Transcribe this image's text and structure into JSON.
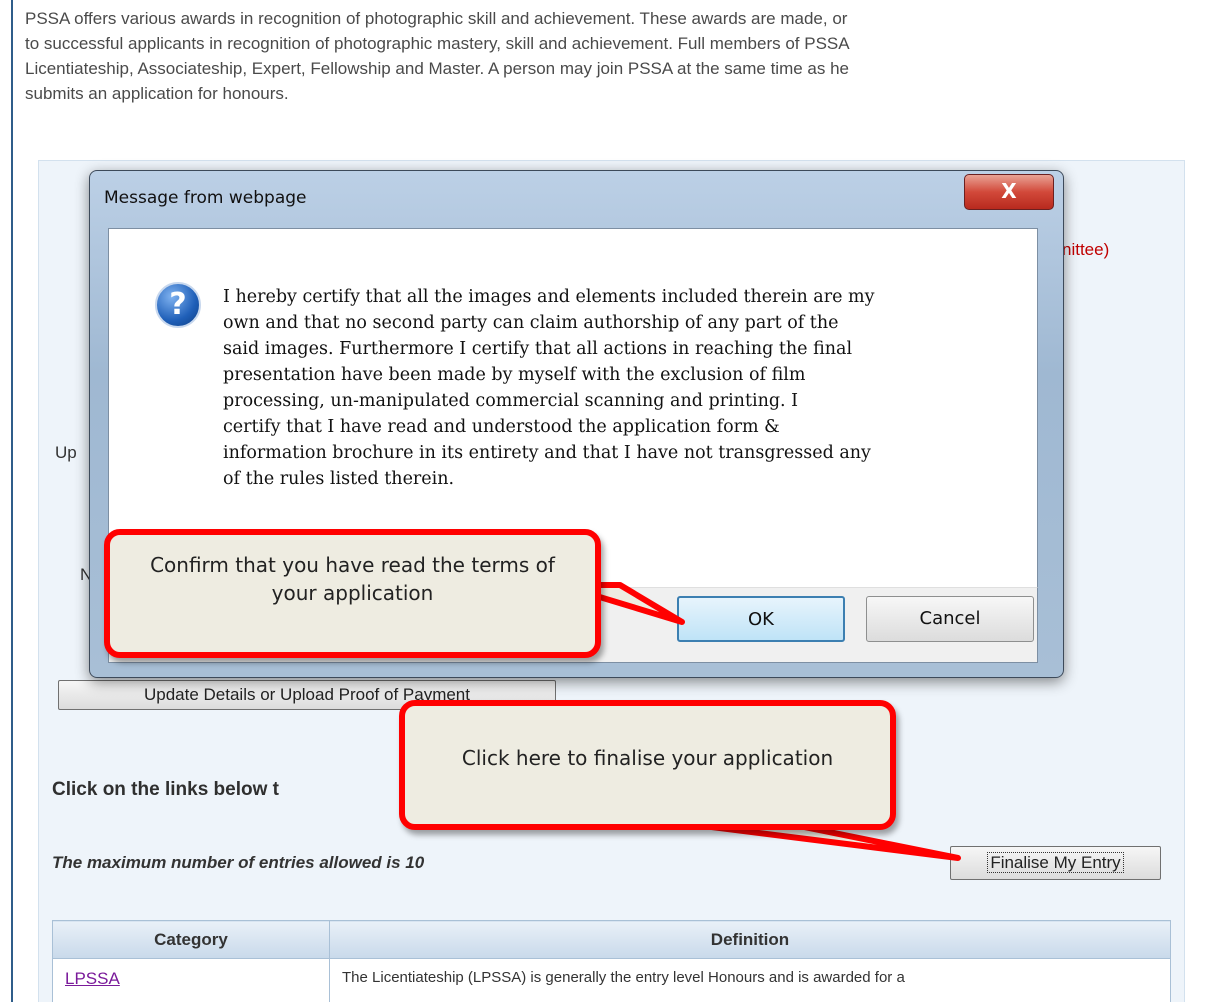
{
  "intro_lines": [
    "PSSA offers various awards in recognition of photographic skill and achievement. These awards are made, or",
    "to successful applicants in recognition of photographic mastery, skill and achievement. Full members of PSSA",
    "Licentiateship, Associateship, Expert, Fellowship and Master. A person may join PSSA at the same time as he",
    "submits an application for honours."
  ],
  "partials": {
    "committee": "nittee)",
    "up": "Up",
    "n": "N"
  },
  "update_button": "Update Details or Upload Proof of Payment",
  "links_heading": "Click on the links below t",
  "max_note": "The maximum number of entries allowed is 10",
  "finalise_button": "Finalise My Entry",
  "table": {
    "headers": [
      "Category",
      "Definition"
    ],
    "rows": [
      {
        "category": "LPSSA",
        "definition": "The Licentiateship (LPSSA) is generally the entry level Honours and is awarded for a"
      }
    ]
  },
  "dialog": {
    "title": "Message from webpage",
    "close_label": "X",
    "icon": "question-icon",
    "message_lines": [
      "I hereby certify that all the images and elements included therein are my",
      "own and that no second party can claim authorship of any part of the",
      "said images. Furthermore I certify that all actions in reaching the final",
      "presentation have been made by myself with the exclusion of film",
      "processing, un-manipulated commercial scanning and printing.  I",
      "certify that I have read and understood the application form &",
      "information brochure in its entirety and that I have not transgressed any",
      "of the rules listed therein."
    ],
    "ok_label": "OK",
    "cancel_label": "Cancel"
  },
  "callouts": {
    "confirm": "Confirm that you have read the terms of your application",
    "finalise": "Click here to finalise your application"
  },
  "colors": {
    "callout_border": "#ff0000",
    "callout_fill": "#eeece1",
    "link": "#7a1a9a",
    "accent_red": "#c00000"
  }
}
